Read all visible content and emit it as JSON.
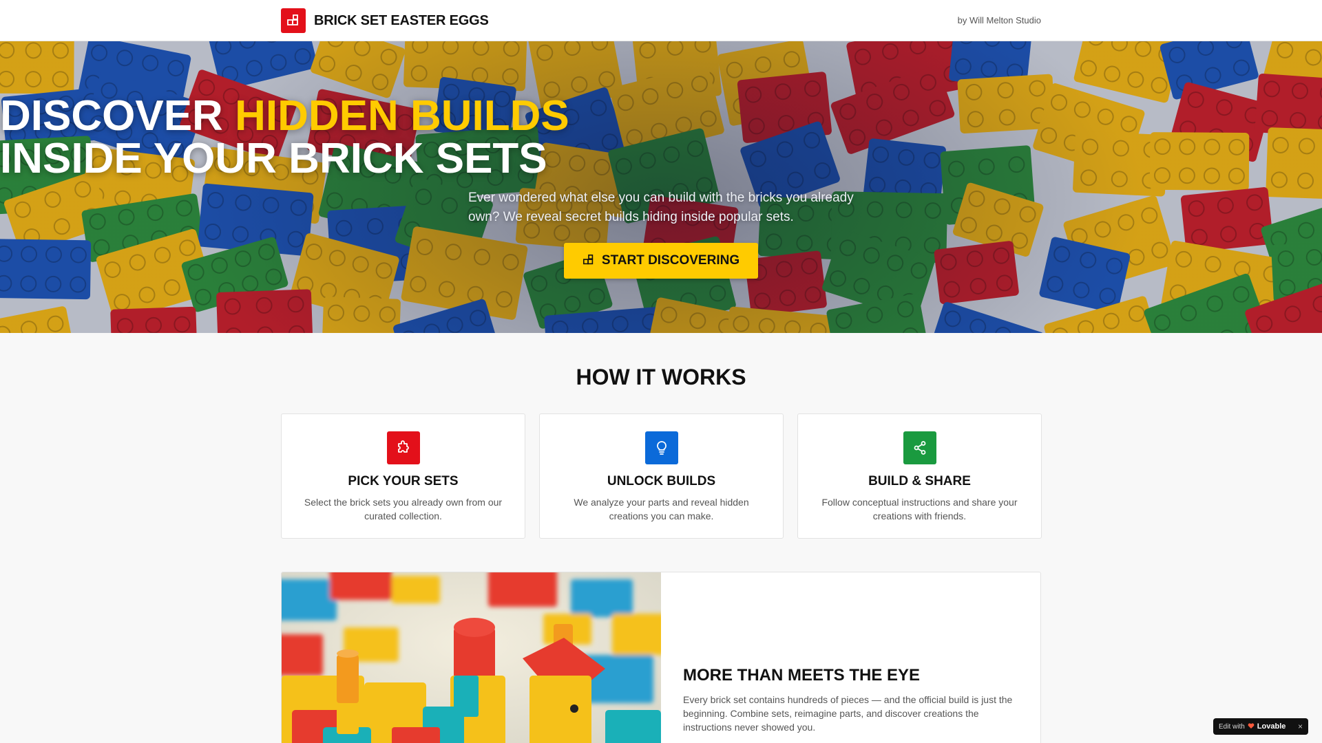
{
  "header": {
    "brand_name": "BRICK SET EASTER EGGS",
    "byline": "by Will Melton Studio"
  },
  "hero": {
    "title_part1": "DISCOVER ",
    "title_highlight": "HIDDEN BUILDS",
    "title_line2": "INSIDE YOUR BRICK SETS",
    "subtitle": "Ever wondered what else you can build with the bricks you already own? We reveal secret builds hiding inside popular sets.",
    "cta_label": "START DISCOVERING",
    "cta_icon": "blocks-icon"
  },
  "how_it_works": {
    "title": "HOW IT WORKS",
    "cards": [
      {
        "icon": "puzzle-icon",
        "color": "#e3101a",
        "title": "PICK YOUR SETS",
        "description": "Select the brick sets you already own from our curated collection."
      },
      {
        "icon": "lightbulb-icon",
        "color": "#0b6ad9",
        "title": "UNLOCK BUILDS",
        "description": "We analyze your parts and reveal hidden creations you can make."
      },
      {
        "icon": "share-icon",
        "color": "#1a9a3f",
        "title": "BUILD & SHARE",
        "description": "Follow conceptual instructions and share your creations with friends."
      }
    ]
  },
  "feature": {
    "title": "MORE THAN MEETS THE EYE",
    "text": "Every brick set contains hundreds of pieces — and the official build is just the beginning. Combine sets, reimagine parts, and discover creations the instructions never showed you."
  },
  "badge": {
    "prefix": "Edit with",
    "brand": "Lovable",
    "close": "×"
  },
  "colors": {
    "brand_red": "#e3101a",
    "accent_yellow": "#ffcb00",
    "blue": "#0b6ad9",
    "green": "#1a9a3f"
  }
}
